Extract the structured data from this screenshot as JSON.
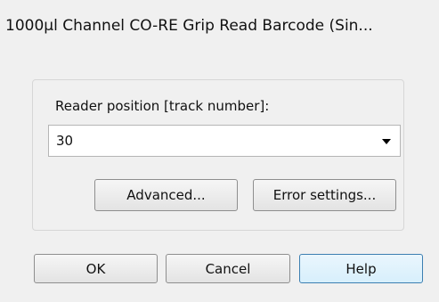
{
  "window": {
    "title": "1000µl Channel CO-RE Grip Read Barcode (Sin..."
  },
  "form": {
    "reader_position_label": "Reader position [track number]:",
    "reader_position_value": "30"
  },
  "buttons": {
    "advanced": "Advanced...",
    "error_settings": "Error settings...",
    "ok": "OK",
    "cancel": "Cancel",
    "help": "Help"
  },
  "colors": {
    "dialog_bg": "#f0f0f0",
    "help_button_border": "#3c7fb1"
  },
  "icons": {
    "dropdown": "chevron-down-icon"
  }
}
